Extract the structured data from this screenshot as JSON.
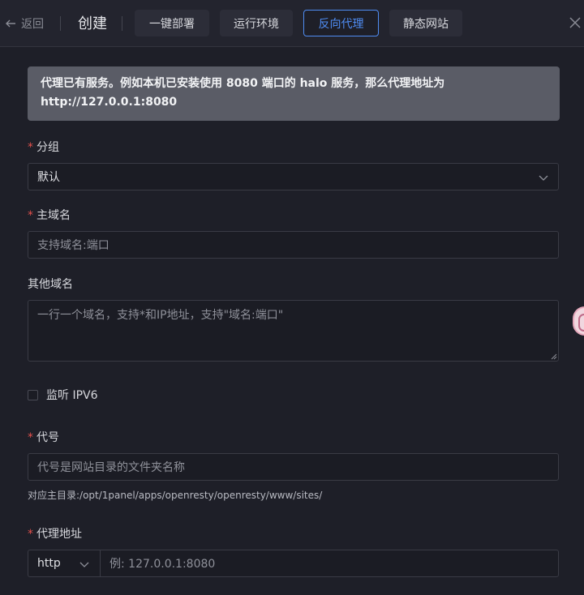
{
  "header": {
    "back_label": "返回",
    "title": "创建",
    "tabs": [
      {
        "label": "一键部署",
        "active": false
      },
      {
        "label": "运行环境",
        "active": false
      },
      {
        "label": "反向代理",
        "active": true
      },
      {
        "label": "静态网站",
        "active": false
      }
    ]
  },
  "alert": {
    "line1": "代理已有服务。例如本机已安装使用 8080 端口的 halo 服务，那么代理地址为",
    "line2": "http://127.0.0.1:8080"
  },
  "form": {
    "group": {
      "label": "分组",
      "value": "默认"
    },
    "primary_domain": {
      "label": "主域名",
      "placeholder": "支持域名:端口"
    },
    "other_domains": {
      "label": "其他域名",
      "placeholder": "一行一个域名，支持*和IP地址，支持\"域名:端口\""
    },
    "ipv6": {
      "label": "监听 IPV6",
      "checked": false
    },
    "alias": {
      "label": "代号",
      "placeholder": "代号是网站目录的文件夹名称"
    },
    "site_dir_hint": "对应主目录:/opt/1panel/apps/openresty/openresty/www/sites/",
    "proxy": {
      "label": "代理地址",
      "protocol": "http",
      "placeholder": "例: 127.0.0.1:8080"
    }
  },
  "colors": {
    "accent": "#4f8cf2",
    "required": "#e2504c",
    "background": "#1e1f28"
  }
}
